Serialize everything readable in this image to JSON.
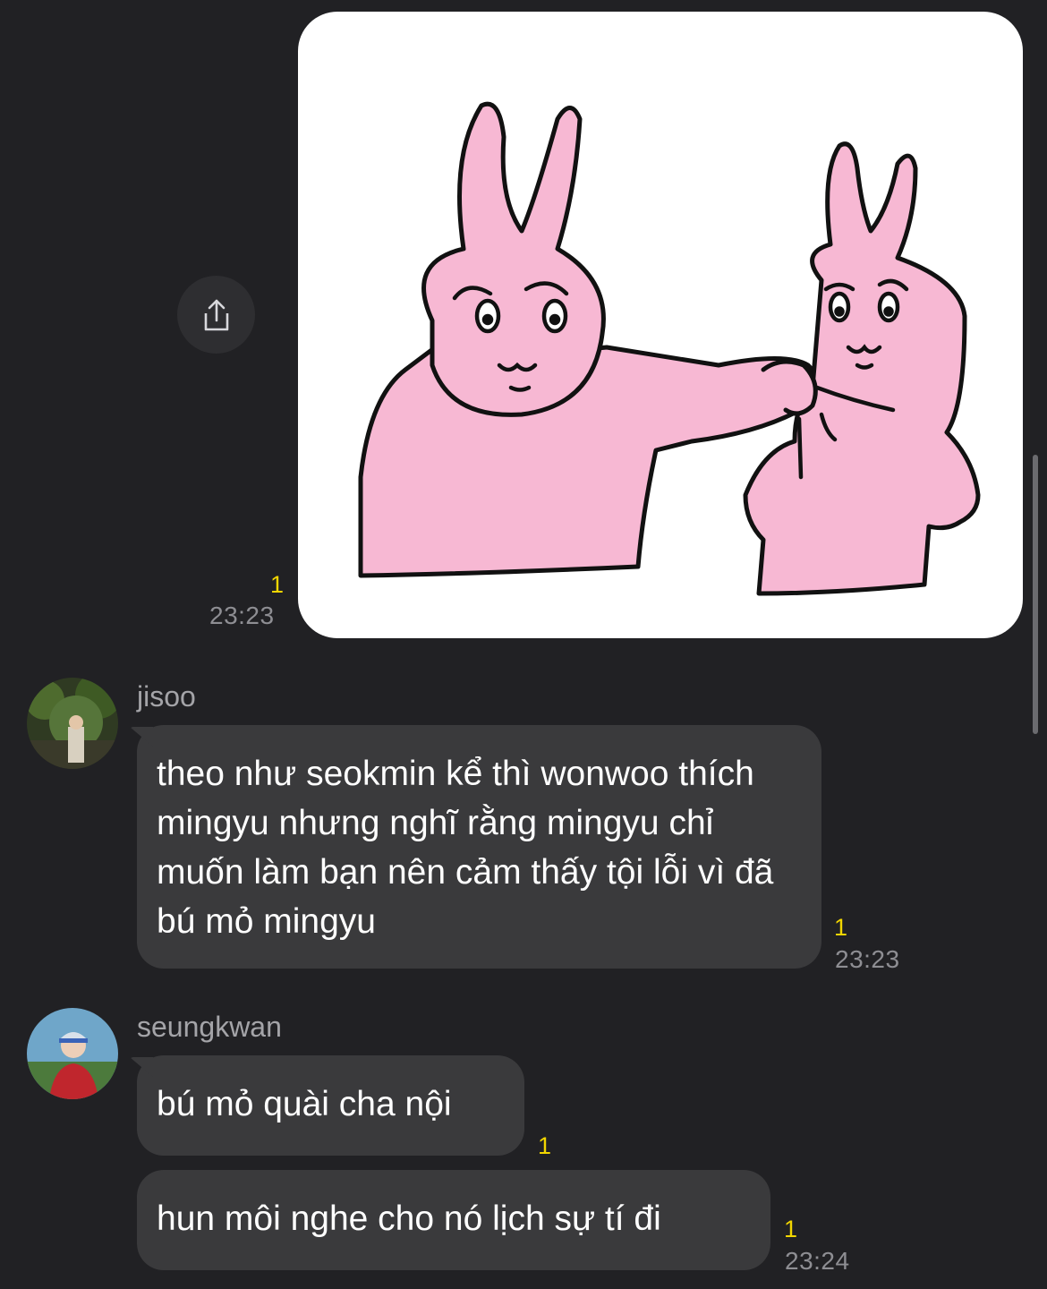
{
  "conversation": {
    "sticker_message": {
      "read_count": "1",
      "time": "23:23",
      "sticker": "pink-rabbit-pinching-cheek"
    },
    "share_icon": "share-icon",
    "messages": [
      {
        "sender": "jisoo",
        "text": "theo như seokmin kể thì wonwoo thích mingyu nhưng nghĩ rằng mingyu chỉ muốn làm bạn nên cảm thấy tội lỗi vì đã bú mỏ mingyu",
        "read_count": "1",
        "time": "23:23"
      },
      {
        "sender": "seungkwan",
        "text": "bú mỏ quài cha nội",
        "read_count": "1"
      },
      {
        "sender": "seungkwan",
        "text": "hun môi nghe cho nó lịch sự tí đi",
        "read_count": "1",
        "time": "23:24"
      }
    ]
  },
  "colors": {
    "background": "#212124",
    "bubble": "#3a3a3c",
    "read_count": "#f2d600",
    "time": "#8e8e93",
    "rabbit_pink": "#f7b8d3"
  }
}
